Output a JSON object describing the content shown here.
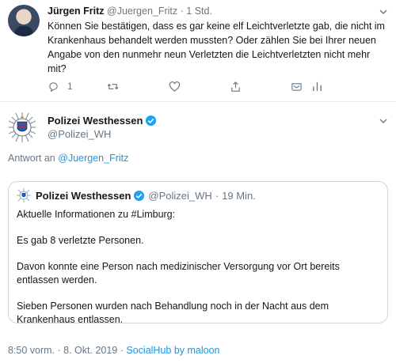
{
  "reply_tweet": {
    "author_name": "Jürgen Fritz",
    "author_handle": "@Juergen_Fritz",
    "separator": "·",
    "time": "1 Std.",
    "text": "Können Sie bestätigen, dass es gar keine elf Leichtverletzte gab, die nicht im Krankenhaus behandelt werden mussten? Oder zählen Sie bei Ihrer neuen Angabe von den nunmehr neun Verletzten die Leichtverletzten nicht mehr mit?",
    "reply_count": "1",
    "icons": {
      "reply": "reply-icon",
      "retweet": "retweet-icon",
      "like": "heart-icon",
      "share": "share-icon",
      "dm": "direct-message-icon",
      "analytics": "analytics-icon",
      "menu": "chevron-down-icon"
    }
  },
  "main_tweet": {
    "author_name": "Polizei Westhessen",
    "author_handle": "@Polizei_WH",
    "reply_to_prefix": "Antwort an",
    "reply_to_handle": "@Juergen_Fritz",
    "timestamp": "8:50 vorm. · 8. Okt. 2019 ·",
    "source": "SocialHub by maloon"
  },
  "quoted_tweet": {
    "author_name": "Polizei Westhessen",
    "author_handle": "@Polizei_WH",
    "separator": "·",
    "time": "19 Min.",
    "paragraphs": [
      "Aktuelle Informationen zu #Limburg:",
      "Es gab 8 verletzte Personen.",
      "Davon konnte eine Person nach medizinischer Versorgung vor Ort bereits entlassen werden.",
      "Sieben Personen wurden nach Behandlung noch in der Nacht aus dem Krankenhaus entlassen."
    ]
  },
  "colors": {
    "link": "#1b95e0",
    "muted": "#657786",
    "text": "#14171a",
    "border": "#ccd6dd",
    "verified": "#1da1f2"
  }
}
